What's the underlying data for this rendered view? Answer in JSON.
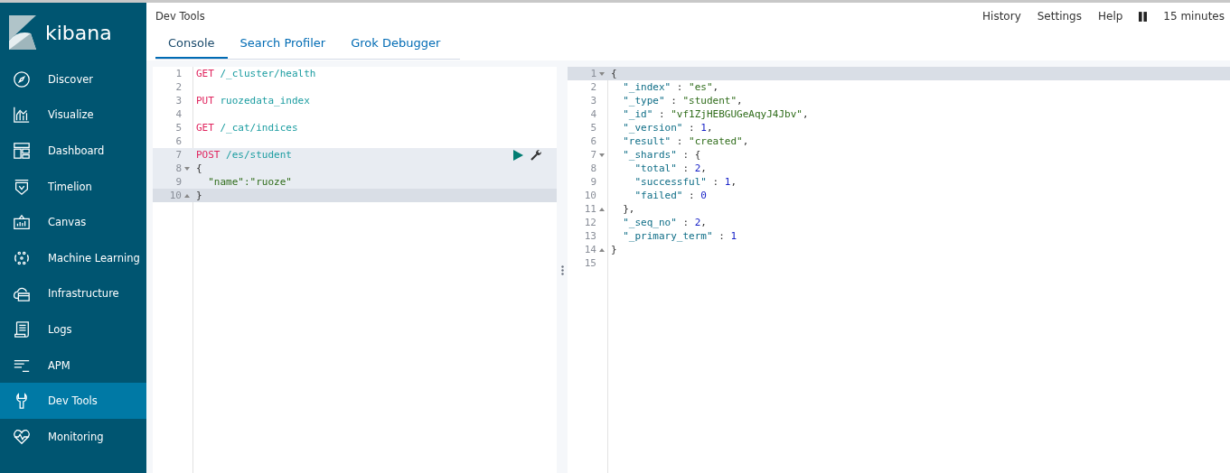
{
  "sidebar": {
    "logo": "kibana",
    "items": [
      {
        "label": "Discover",
        "selected": false
      },
      {
        "label": "Visualize",
        "selected": false
      },
      {
        "label": "Dashboard",
        "selected": false
      },
      {
        "label": "Timelion",
        "selected": false
      },
      {
        "label": "Canvas",
        "selected": false
      },
      {
        "label": "Machine Learning",
        "selected": false
      },
      {
        "label": "Infrastructure",
        "selected": false
      },
      {
        "label": "Logs",
        "selected": false
      },
      {
        "label": "APM",
        "selected": false
      },
      {
        "label": "Dev Tools",
        "selected": true
      },
      {
        "label": "Monitoring",
        "selected": false
      }
    ]
  },
  "header": {
    "title": "Dev Tools",
    "links": [
      "History",
      "Settings",
      "Help"
    ],
    "time": "15 minutes"
  },
  "tabs": [
    {
      "label": "Console",
      "selected": true
    },
    {
      "label": "Search Profiler",
      "selected": false
    },
    {
      "label": "Grok Debugger",
      "selected": false
    }
  ],
  "request": {
    "lines": [
      {
        "num": "1",
        "fold_start": false,
        "fold_end": false,
        "highlighted": false,
        "active": false,
        "tokens": [
          {
            "kind": "method",
            "text": "GET"
          },
          {
            "kind": "path",
            "text": " /_cluster/health"
          }
        ]
      },
      {
        "num": "2",
        "fold_start": false,
        "fold_end": false,
        "highlighted": false,
        "active": false
      },
      {
        "num": "3",
        "fold_start": false,
        "fold_end": false,
        "highlighted": false,
        "active": false,
        "tokens": [
          {
            "kind": "method",
            "text": "PUT"
          },
          {
            "kind": "path",
            "text": " ruozedata_index"
          }
        ]
      },
      {
        "num": "4",
        "fold_start": false,
        "fold_end": false,
        "highlighted": false,
        "active": false
      },
      {
        "num": "5",
        "fold_start": false,
        "fold_end": false,
        "highlighted": false,
        "active": false,
        "tokens": [
          {
            "kind": "method",
            "text": "GET"
          },
          {
            "kind": "path",
            "text": " /_cat/indices"
          }
        ]
      },
      {
        "num": "6",
        "fold_start": false,
        "fold_end": false,
        "highlighted": false,
        "active": false
      },
      {
        "num": "7",
        "fold_start": false,
        "fold_end": false,
        "highlighted": true,
        "active": false,
        "actions": true,
        "tokens": [
          {
            "kind": "method",
            "text": "POST"
          },
          {
            "kind": "path",
            "text": " /es/student"
          }
        ]
      },
      {
        "num": "8",
        "fold_start": true,
        "fold_end": false,
        "highlighted": true,
        "active": false,
        "tokens": [
          {
            "kind": "punct",
            "text": "{"
          }
        ]
      },
      {
        "num": "9",
        "fold_start": false,
        "fold_end": false,
        "highlighted": true,
        "active": false,
        "tokens": [
          {
            "kind": "string",
            "text": "  \"name\":\"ruoze\""
          }
        ]
      },
      {
        "num": "10",
        "fold_start": false,
        "fold_end": true,
        "highlighted": true,
        "active": true,
        "tokens": [
          {
            "kind": "punct",
            "text": "}"
          }
        ]
      }
    ]
  },
  "response": {
    "lines": [
      {
        "num": "1",
        "fold_start": true,
        "fold_end": false,
        "active": true,
        "tokens": [
          {
            "kind": "punct",
            "text": "{"
          }
        ]
      },
      {
        "num": "2",
        "fold_start": false,
        "fold_end": false,
        "active": false,
        "tokens": [
          {
            "kind": "key",
            "text": "  \"_index\""
          },
          {
            "kind": "punct",
            "text": " : "
          },
          {
            "kind": "string",
            "text": "\"es\""
          },
          {
            "kind": "punct",
            "text": ","
          }
        ]
      },
      {
        "num": "3",
        "fold_start": false,
        "fold_end": false,
        "active": false,
        "tokens": [
          {
            "kind": "key",
            "text": "  \"_type\""
          },
          {
            "kind": "punct",
            "text": " : "
          },
          {
            "kind": "string",
            "text": "\"student\""
          },
          {
            "kind": "punct",
            "text": ","
          }
        ]
      },
      {
        "num": "4",
        "fold_start": false,
        "fold_end": false,
        "active": false,
        "tokens": [
          {
            "kind": "key",
            "text": "  \"_id\""
          },
          {
            "kind": "punct",
            "text": " : "
          },
          {
            "kind": "string",
            "text": "\"vf1ZjHEBGUGeAqyJ4Jbv\""
          },
          {
            "kind": "punct",
            "text": ","
          }
        ]
      },
      {
        "num": "5",
        "fold_start": false,
        "fold_end": false,
        "active": false,
        "tokens": [
          {
            "kind": "key",
            "text": "  \"_version\""
          },
          {
            "kind": "punct",
            "text": " : "
          },
          {
            "kind": "number",
            "text": "1"
          },
          {
            "kind": "punct",
            "text": ","
          }
        ]
      },
      {
        "num": "6",
        "fold_start": false,
        "fold_end": false,
        "active": false,
        "tokens": [
          {
            "kind": "key",
            "text": "  \"result\""
          },
          {
            "kind": "punct",
            "text": " : "
          },
          {
            "kind": "string",
            "text": "\"created\""
          },
          {
            "kind": "punct",
            "text": ","
          }
        ]
      },
      {
        "num": "7",
        "fold_start": true,
        "fold_end": false,
        "active": false,
        "tokens": [
          {
            "kind": "key",
            "text": "  \"_shards\""
          },
          {
            "kind": "punct",
            "text": " : {"
          }
        ]
      },
      {
        "num": "8",
        "fold_start": false,
        "fold_end": false,
        "active": false,
        "tokens": [
          {
            "kind": "key",
            "text": "    \"total\""
          },
          {
            "kind": "punct",
            "text": " : "
          },
          {
            "kind": "number",
            "text": "2"
          },
          {
            "kind": "punct",
            "text": ","
          }
        ]
      },
      {
        "num": "9",
        "fold_start": false,
        "fold_end": false,
        "active": false,
        "tokens": [
          {
            "kind": "key",
            "text": "    \"successful\""
          },
          {
            "kind": "punct",
            "text": " : "
          },
          {
            "kind": "number",
            "text": "1"
          },
          {
            "kind": "punct",
            "text": ","
          }
        ]
      },
      {
        "num": "10",
        "fold_start": false,
        "fold_end": false,
        "active": false,
        "tokens": [
          {
            "kind": "key",
            "text": "    \"failed\""
          },
          {
            "kind": "punct",
            "text": " : "
          },
          {
            "kind": "number",
            "text": "0"
          }
        ]
      },
      {
        "num": "11",
        "fold_start": false,
        "fold_end": true,
        "active": false,
        "tokens": [
          {
            "kind": "punct",
            "text": "  },"
          }
        ]
      },
      {
        "num": "12",
        "fold_start": false,
        "fold_end": false,
        "active": false,
        "tokens": [
          {
            "kind": "key",
            "text": "  \"_seq_no\""
          },
          {
            "kind": "punct",
            "text": " : "
          },
          {
            "kind": "number",
            "text": "2"
          },
          {
            "kind": "punct",
            "text": ","
          }
        ]
      },
      {
        "num": "13",
        "fold_start": false,
        "fold_end": false,
        "active": false,
        "tokens": [
          {
            "kind": "key",
            "text": "  \"_primary_term\""
          },
          {
            "kind": "punct",
            "text": " : "
          },
          {
            "kind": "number",
            "text": "1"
          }
        ]
      },
      {
        "num": "14",
        "fold_start": false,
        "fold_end": true,
        "active": false,
        "tokens": [
          {
            "kind": "punct",
            "text": "}"
          }
        ]
      },
      {
        "num": "15",
        "fold_start": false,
        "fold_end": false,
        "active": false
      }
    ]
  }
}
